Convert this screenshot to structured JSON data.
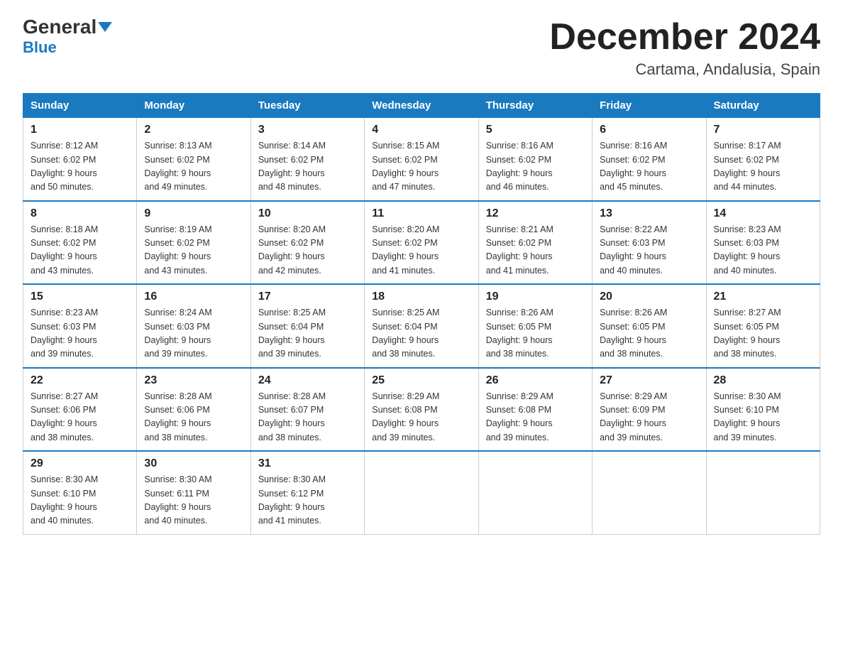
{
  "logo": {
    "general": "General",
    "blue": "Blue",
    "triangle": "▼"
  },
  "title": "December 2024",
  "subtitle": "Cartama, Andalusia, Spain",
  "days_of_week": [
    "Sunday",
    "Monday",
    "Tuesday",
    "Wednesday",
    "Thursday",
    "Friday",
    "Saturday"
  ],
  "weeks": [
    [
      {
        "day": "1",
        "sunrise": "8:12 AM",
        "sunset": "6:02 PM",
        "daylight": "9 hours and 50 minutes."
      },
      {
        "day": "2",
        "sunrise": "8:13 AM",
        "sunset": "6:02 PM",
        "daylight": "9 hours and 49 minutes."
      },
      {
        "day": "3",
        "sunrise": "8:14 AM",
        "sunset": "6:02 PM",
        "daylight": "9 hours and 48 minutes."
      },
      {
        "day": "4",
        "sunrise": "8:15 AM",
        "sunset": "6:02 PM",
        "daylight": "9 hours and 47 minutes."
      },
      {
        "day": "5",
        "sunrise": "8:16 AM",
        "sunset": "6:02 PM",
        "daylight": "9 hours and 46 minutes."
      },
      {
        "day": "6",
        "sunrise": "8:16 AM",
        "sunset": "6:02 PM",
        "daylight": "9 hours and 45 minutes."
      },
      {
        "day": "7",
        "sunrise": "8:17 AM",
        "sunset": "6:02 PM",
        "daylight": "9 hours and 44 minutes."
      }
    ],
    [
      {
        "day": "8",
        "sunrise": "8:18 AM",
        "sunset": "6:02 PM",
        "daylight": "9 hours and 43 minutes."
      },
      {
        "day": "9",
        "sunrise": "8:19 AM",
        "sunset": "6:02 PM",
        "daylight": "9 hours and 43 minutes."
      },
      {
        "day": "10",
        "sunrise": "8:20 AM",
        "sunset": "6:02 PM",
        "daylight": "9 hours and 42 minutes."
      },
      {
        "day": "11",
        "sunrise": "8:20 AM",
        "sunset": "6:02 PM",
        "daylight": "9 hours and 41 minutes."
      },
      {
        "day": "12",
        "sunrise": "8:21 AM",
        "sunset": "6:02 PM",
        "daylight": "9 hours and 41 minutes."
      },
      {
        "day": "13",
        "sunrise": "8:22 AM",
        "sunset": "6:03 PM",
        "daylight": "9 hours and 40 minutes."
      },
      {
        "day": "14",
        "sunrise": "8:23 AM",
        "sunset": "6:03 PM",
        "daylight": "9 hours and 40 minutes."
      }
    ],
    [
      {
        "day": "15",
        "sunrise": "8:23 AM",
        "sunset": "6:03 PM",
        "daylight": "9 hours and 39 minutes."
      },
      {
        "day": "16",
        "sunrise": "8:24 AM",
        "sunset": "6:03 PM",
        "daylight": "9 hours and 39 minutes."
      },
      {
        "day": "17",
        "sunrise": "8:25 AM",
        "sunset": "6:04 PM",
        "daylight": "9 hours and 39 minutes."
      },
      {
        "day": "18",
        "sunrise": "8:25 AM",
        "sunset": "6:04 PM",
        "daylight": "9 hours and 38 minutes."
      },
      {
        "day": "19",
        "sunrise": "8:26 AM",
        "sunset": "6:05 PM",
        "daylight": "9 hours and 38 minutes."
      },
      {
        "day": "20",
        "sunrise": "8:26 AM",
        "sunset": "6:05 PM",
        "daylight": "9 hours and 38 minutes."
      },
      {
        "day": "21",
        "sunrise": "8:27 AM",
        "sunset": "6:05 PM",
        "daylight": "9 hours and 38 minutes."
      }
    ],
    [
      {
        "day": "22",
        "sunrise": "8:27 AM",
        "sunset": "6:06 PM",
        "daylight": "9 hours and 38 minutes."
      },
      {
        "day": "23",
        "sunrise": "8:28 AM",
        "sunset": "6:06 PM",
        "daylight": "9 hours and 38 minutes."
      },
      {
        "day": "24",
        "sunrise": "8:28 AM",
        "sunset": "6:07 PM",
        "daylight": "9 hours and 38 minutes."
      },
      {
        "day": "25",
        "sunrise": "8:29 AM",
        "sunset": "6:08 PM",
        "daylight": "9 hours and 39 minutes."
      },
      {
        "day": "26",
        "sunrise": "8:29 AM",
        "sunset": "6:08 PM",
        "daylight": "9 hours and 39 minutes."
      },
      {
        "day": "27",
        "sunrise": "8:29 AM",
        "sunset": "6:09 PM",
        "daylight": "9 hours and 39 minutes."
      },
      {
        "day": "28",
        "sunrise": "8:30 AM",
        "sunset": "6:10 PM",
        "daylight": "9 hours and 39 minutes."
      }
    ],
    [
      {
        "day": "29",
        "sunrise": "8:30 AM",
        "sunset": "6:10 PM",
        "daylight": "9 hours and 40 minutes."
      },
      {
        "day": "30",
        "sunrise": "8:30 AM",
        "sunset": "6:11 PM",
        "daylight": "9 hours and 40 minutes."
      },
      {
        "day": "31",
        "sunrise": "8:30 AM",
        "sunset": "6:12 PM",
        "daylight": "9 hours and 41 minutes."
      },
      null,
      null,
      null,
      null
    ]
  ],
  "labels": {
    "sunrise": "Sunrise:",
    "sunset": "Sunset:",
    "daylight": "Daylight:"
  }
}
